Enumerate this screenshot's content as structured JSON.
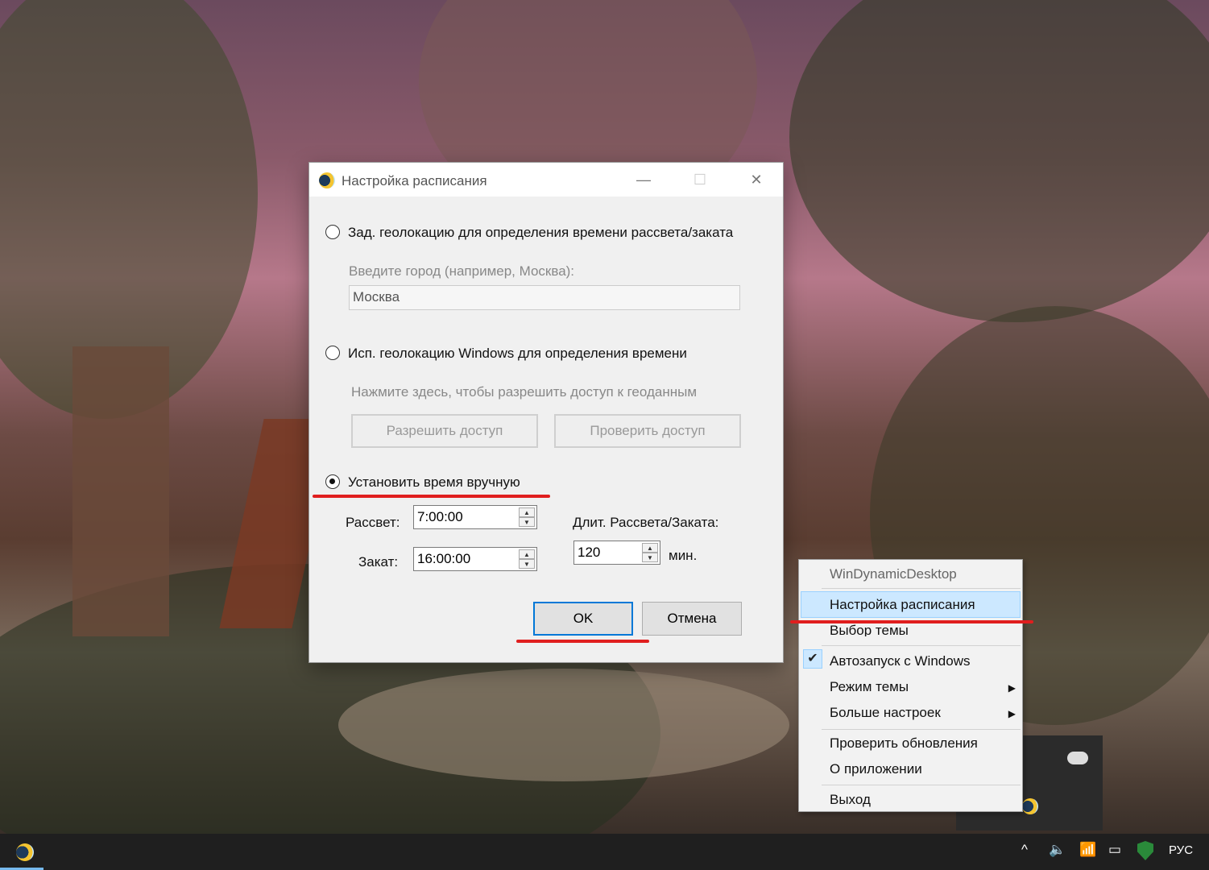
{
  "dialog": {
    "title": "Настройка расписания",
    "minimize_glyph": "—",
    "maximize_glyph": "☐",
    "close_glyph": "✕",
    "options": {
      "geo_city_label": "Зад. геолокацию для определения времени рассвета/заката",
      "city_prompt": "Введите город (например, Москва):",
      "city_value": "Москва",
      "windows_geo_label": "Исп. геолокацию Windows для определения времени",
      "windows_geo_hint": "Нажмите здесь, чтобы разрешить доступ к геоданным",
      "grant_access_button": "Разрешить доступ",
      "check_access_button": "Проверить доступ",
      "manual_label": "Установить время вручную",
      "selected": "manual"
    },
    "manual": {
      "sunrise_label": "Рассвет:",
      "sunrise_value": "7:00:00",
      "sunset_label": "Закат:",
      "sunset_value": "16:00:00",
      "duration_label": "Длит. Рассвета/Заката:",
      "duration_value": "120",
      "duration_unit": "мин."
    },
    "ok_button": "OK",
    "cancel_button": "Отмена"
  },
  "tray_menu": {
    "header": "WinDynamicDesktop",
    "items": [
      {
        "label": "Настройка расписания",
        "highlighted": true
      },
      {
        "label": "Выбор темы"
      },
      {
        "label": "Автозапуск с Windows",
        "checked": true
      },
      {
        "label": "Режим темы",
        "submenu": true
      },
      {
        "label": "Больше настроек",
        "submenu": true
      },
      {
        "label": "Проверить обновления"
      },
      {
        "label": "О приложении"
      },
      {
        "label": "Выход"
      }
    ]
  },
  "taskbar": {
    "language": "РУС",
    "chevron_glyph": "^"
  },
  "colors": {
    "annotation_red": "#e01e1e",
    "menu_highlight": "#cce8ff",
    "accent": "#0078d7"
  }
}
